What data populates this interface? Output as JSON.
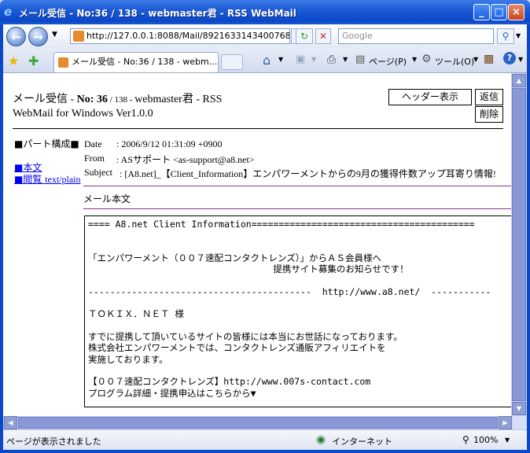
{
  "window": {
    "title": "メール受信 - No:36 / 138 - webmaster君 - RSS WebMail",
    "minimize": "_",
    "maximize": "□",
    "close": "×"
  },
  "address_bar": {
    "url": "http://127.0.0.1:8088/Mail/89216331434007689(",
    "search_placeholder": "Google"
  },
  "tab": {
    "label": "メール受信 - No:36 / 138 - webm..."
  },
  "toolbar": {
    "page_label": "ページ(P)",
    "tools_label": "ツール(O)"
  },
  "page": {
    "heading_prefix": "メール受信 - ",
    "heading_no": "No: 36",
    "heading_count": " / 138 - ",
    "heading_suffix": "webmaster君 - RSS",
    "heading_line2": "WebMail for Windows Ver1.0.0",
    "header_view_button": "ヘッダー表示",
    "reply_button": "返信",
    "delete_button": "削除",
    "parts_label": "■パート構成■",
    "part_body_link": "■本文",
    "part_view_link": "■閲覧",
    "part_type_link": "text/plain",
    "date_label": "Date",
    "date_value": ": 2006/9/12 01:31:09 +0900",
    "from_label": "From",
    "from_value": ": ASサポート <as-support@a8.net>",
    "subject_label": "Subject",
    "subject_value": ": [A8.net]_【Client_Information】エンパワーメントからの9月の獲得件数アップ耳寄り情報!",
    "body_label": "メール本文",
    "body_lines": [
      "==== A8.net Client Information=========================================",
      "",
      "",
      "「エンパワーメント（００７速配コンタクトレンズ）」からＡＳ会員様へ",
      "                                  提携サイト募集のお知らせです！",
      "",
      "-----------------------------------------  http://www.a8.net/  -----------",
      "",
      "ＴＯＫＩＸ．ＮＥＴ 様",
      "",
      "すでに提携して頂いているサイトの皆様には本当にお世話になっております。",
      "株式会社エンパワーメントでは、コンタクトレンズ通販アフィリエイトを",
      "実施しております。",
      "",
      "【００７速配コンタクトレンズ】http://www.007s-contact.com",
      "プログラム詳細・提携申込はこちらから▼"
    ]
  },
  "status": {
    "text": "ページが表示されました",
    "zone": "インターネット",
    "zoom": "100%"
  }
}
